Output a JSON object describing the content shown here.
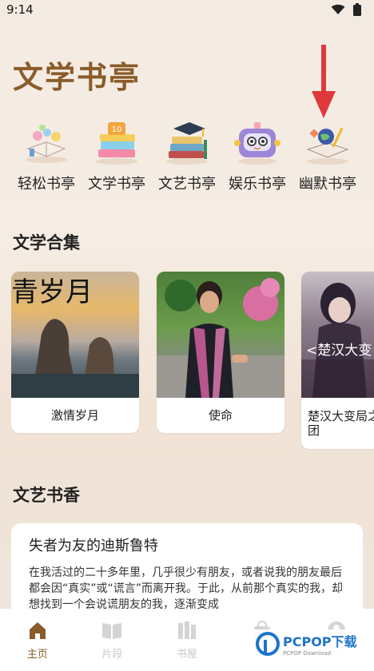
{
  "status_bar": {
    "time": "9:14"
  },
  "page_title": "文学书亭",
  "categories": [
    {
      "label": "轻松书亭",
      "icon": "books-flowers-icon"
    },
    {
      "label": "文学书亭",
      "icon": "book-stack-clock-icon"
    },
    {
      "label": "文艺书亭",
      "icon": "graduation-books-icon"
    },
    {
      "label": "娱乐书亭",
      "icon": "robot-toy-icon"
    },
    {
      "label": "幽默书亭",
      "icon": "open-book-globe-icon"
    }
  ],
  "sections": {
    "collection_title": "文学合集",
    "collection_cards": [
      {
        "label": "激情岁月",
        "overlay": "青岁月"
      },
      {
        "label": "使命"
      },
      {
        "label": "楚汉大变局之项羽传团",
        "overlay": "<楚汉大变"
      }
    ],
    "featured_title": "文艺书香",
    "article": {
      "title": "失者为友的迪斯鲁特",
      "body": "在我活过的二十多年里，几乎很少有朋友，或者说我的朋友最后都会因“真实”或“谎言”而离开我。于此，从前那个真实的我，却想找到一个会说谎朋友的我，逐渐变成"
    }
  },
  "tabbar": [
    {
      "label": "主页",
      "active": true,
      "icon": "home-icon"
    },
    {
      "label": "片段",
      "active": false,
      "icon": "open-book-icon"
    },
    {
      "label": "书屋",
      "active": false,
      "icon": "bookshelf-icon"
    },
    {
      "label": "",
      "active": false,
      "icon": "bag-icon"
    },
    {
      "label": "个人",
      "active": false,
      "icon": "profile-icon"
    }
  ],
  "watermark": {
    "text": "PCPOP下载",
    "sub": "PCPOP Download"
  },
  "colors": {
    "accent": "#8a5c2a",
    "arrow": "#e0393b",
    "watermark": "#1d74c9"
  }
}
